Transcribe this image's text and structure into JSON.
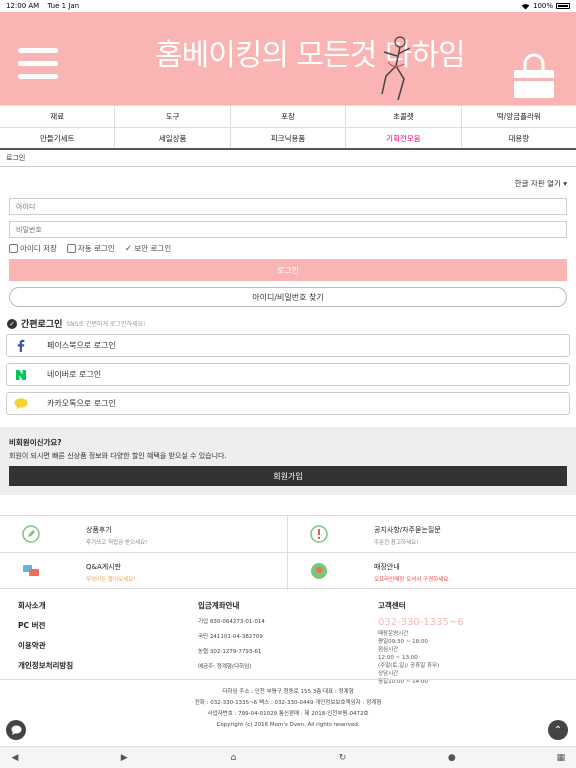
{
  "status": {
    "time": "12:00 AM",
    "date": "Tue 1 Jan",
    "battery": "100%"
  },
  "banner": {
    "logo_text": "홈베이킹의 모든것 다하임"
  },
  "nav": {
    "row1": [
      "재료",
      "도구",
      "포장",
      "초콜렛",
      "떡/앙금플라워"
    ],
    "row2": [
      "만들기세트",
      "세일상품",
      "피크닉용품",
      "기획전모음",
      "대용량"
    ],
    "active": "기획전모음"
  },
  "breadcrumb": "로그인",
  "login": {
    "keyboard_toggle": "한글 자판 열기 ▾",
    "id_placeholder": "아이디",
    "pw_placeholder": "비밀번호",
    "save_id": "아이디 저장",
    "auto_login": "자동 로그인",
    "secure_login": "보안 로그인",
    "login_button": "로그인",
    "find_button": "아이디/비밀번호 찾기"
  },
  "simple": {
    "title": "간편로그인",
    "subtitle": "SNS로 간편하게 로그인하세요!",
    "facebook": "페이스북으로 로그인",
    "naver": "네이버로 로그인",
    "kakao": "카카오톡으로 로그인"
  },
  "member": {
    "question": "비회원이신가요?",
    "desc": "회원이 되시면 빠른 신상품 정보와 다양한 할인 혜택을 받으실 수 있습니다.",
    "join_button": "회원가입"
  },
  "quick": [
    {
      "title": "상품후기",
      "sub": "후기쓰고 적립금 받으세요!"
    },
    {
      "title": "공지사항/자주묻는질문",
      "sub": "주문전 참고하세요!"
    },
    {
      "title": "Q&A게시판",
      "sub": "무엇이든 물어보세요!"
    },
    {
      "title": "매장안내",
      "sub": "오프라인매장 오셔서 구경하세요."
    }
  ],
  "footer": {
    "links": [
      "회사소개",
      "PC 버전",
      "이용약관",
      "개인정보처리방침"
    ],
    "bank_title": "입금계좌안내",
    "bank": [
      "기업 630-064273-01-014",
      "국민 241101-04-382709",
      "농협 302-1279-7793-61",
      "예금주: 정계형(다하임)"
    ],
    "cs_title": "고객센터",
    "cs_phone": "032-330-1335~6",
    "cs_lines": [
      "매장운영시간",
      "평일09:30 ~ 18:00",
      "점심시간",
      "12:00 ~ 13:00",
      "(주말(토,일)/ 공휴일 휴무)",
      "상담시간",
      "평일10:00 ~ 14:00"
    ]
  },
  "company": {
    "line1": "다하임    주소 : 인천 부평구 청동로 155 3층    대표 : 정계형",
    "line2": "전화 : 032-330-1335~6    팩스 : 032-330-0449    개인정보보호책임자 : 정계형",
    "line3": "사업자번호 : 799-04-01029    통신판매 : 제 2018-인천부평-0472호",
    "line4": "Copyright (c) 2016 Mom's Oven. All rights reserved."
  },
  "colors": {
    "pink": "#fbb4b4",
    "active": "#e4007f",
    "dark": "#333333"
  }
}
